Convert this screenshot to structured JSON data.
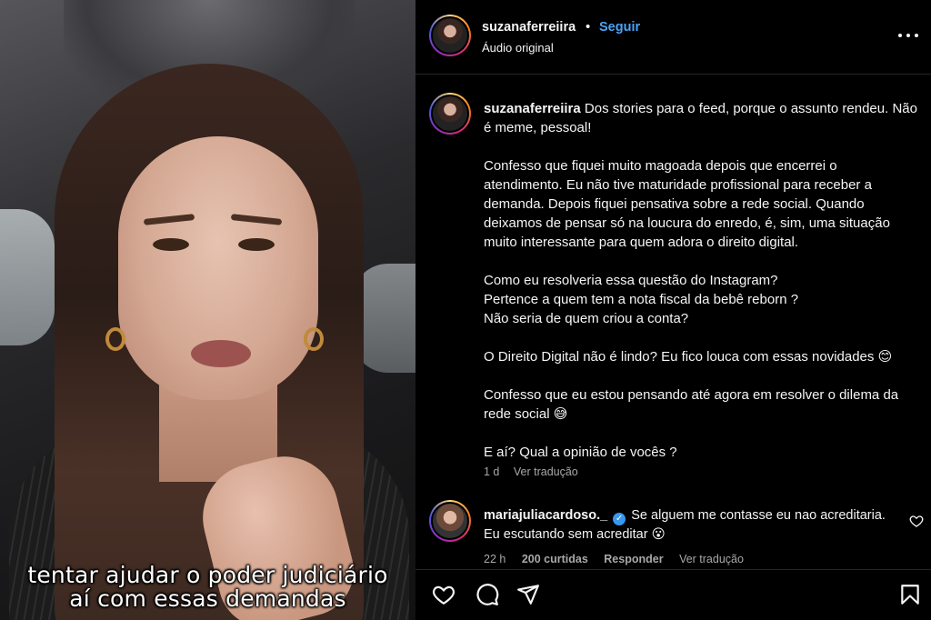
{
  "video": {
    "caption_line1": "tentar ajudar o poder judiciário",
    "caption_line2": "aí com essas demandas"
  },
  "header": {
    "username": "suzanaferreiira",
    "separator": "•",
    "follow_label": "Seguir",
    "audio_label": "Áudio original",
    "more_icon": "more-horizontal-icon"
  },
  "caption": {
    "username": "suzanaferreiira",
    "text": " Dos stories para o feed, porque o assunto rendeu. Não é meme, pessoal!\n\nConfesso que fiquei muito magoada depois que encerrei o atendimento. Eu não tive maturidade profissional para receber a demanda. Depois fiquei pensativa sobre a rede social. Quando deixamos de pensar só na loucura do enredo, é, sim, uma situação muito interessante para quem adora o direito digital.\n\nComo eu resolveria essa questão do Instagram?\nPertence a quem tem a nota fiscal da bebê reborn ?\nNão seria de quem criou a conta?\n\nO Direito Digital não é lindo? Eu fico louca com essas novidades 😊\n\nConfesso que eu estou pensando até agora em resolver o dilema da rede social 😅\n\nE aí? Qual a opinião de vocês ?",
    "time": "1 d",
    "translate_label": "Ver tradução"
  },
  "comment": {
    "username": "mariajuliacardoso._",
    "verified_mark": "✓",
    "text": " Se alguem me contasse eu nao acreditaria. Eu escutando sem acreditar 😮",
    "time": "22 h",
    "likes": "200 curtidas",
    "reply_label": "Responder",
    "translate_label": "Ver tradução"
  },
  "actions": {
    "icons": [
      "heart-icon",
      "comment-icon",
      "share-icon",
      "bookmark-icon"
    ]
  },
  "colors": {
    "background": "#000000",
    "text": "#f5f5f5",
    "muted": "#a8a8a8",
    "link": "#4aa3f6",
    "divider": "#262626"
  }
}
